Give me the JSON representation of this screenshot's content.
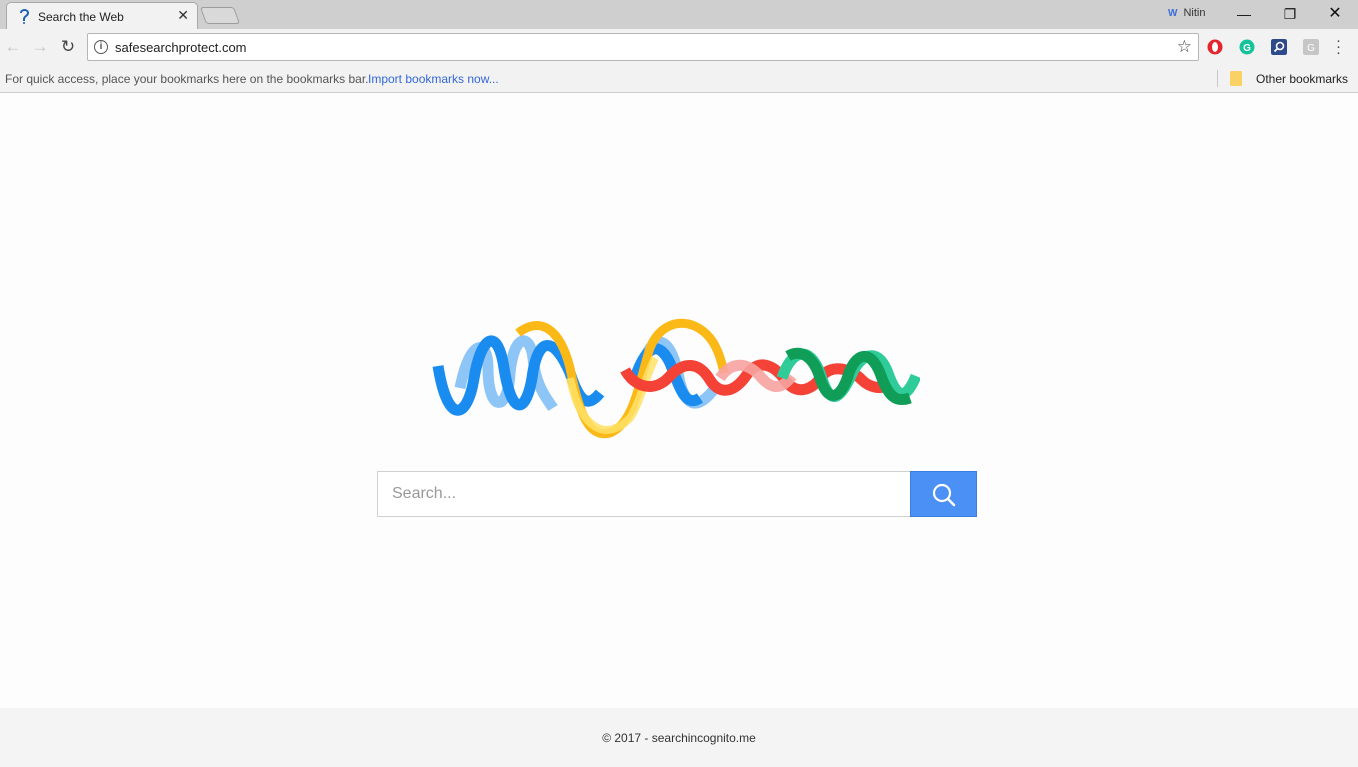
{
  "tab": {
    "title": "Search the Web"
  },
  "window": {
    "profile_name": "Nitin"
  },
  "toolbar": {
    "url": "safesearchprotect.com"
  },
  "bookmarks_bar": {
    "hint": "For quick access, place your bookmarks here on the bookmarks bar.",
    "import_link": "Import bookmarks now...",
    "other_bookmarks": "Other bookmarks"
  },
  "search": {
    "placeholder": "Search..."
  },
  "footer": {
    "text": "© 2017 - searchincognito.me"
  },
  "colors": {
    "search_button": "#4a90f5",
    "logo_blue": "#1a8cf0",
    "logo_yellow": "#fbb917",
    "logo_red": "#f44336",
    "logo_green": "#0f9d58"
  }
}
